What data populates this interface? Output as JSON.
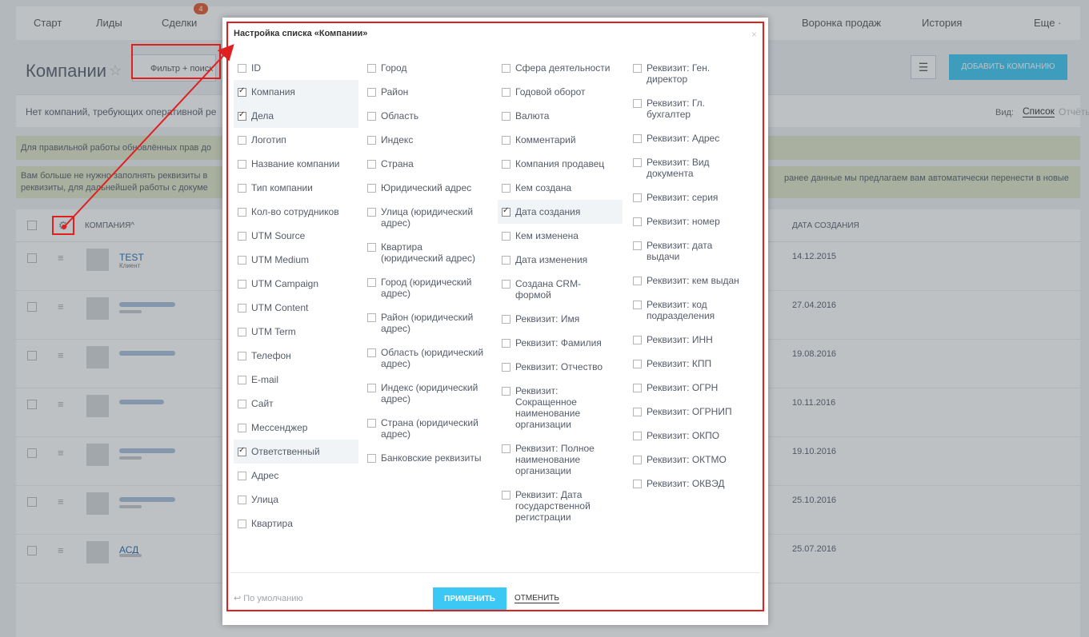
{
  "nav": {
    "items": [
      "Старт",
      "Лиды",
      "Сделки",
      "Воронка продаж",
      "История",
      "Еще ·"
    ],
    "badge": "4"
  },
  "page": {
    "title": "Компании",
    "filter_placeholder": "Фильтр + поиск",
    "add_button": "ДОБАВИТЬ КОМПАНИЮ",
    "info_text": "Нет компаний, требующих оперативной ре",
    "view_label": "Вид:",
    "view_list": "Список",
    "view_reports": "Отчёты",
    "notice1": "Для правильной работы обновлённых прав до",
    "notice2_line1": "Вам больше не нужно заполнять реквизиты в",
    "notice2_line2": "реквизиты, для дальнейшей работы с докуме",
    "notice2_right": "ранее данные мы предлагаем вам автоматически перенести в новые"
  },
  "table": {
    "col_company": "КОМПАНИЯ^",
    "col_date": "ДАТА СОЗДАНИЯ",
    "rows": [
      {
        "name": "TEST",
        "type": "Клиент",
        "date": "14.12.2015"
      },
      {
        "name": "",
        "type": "",
        "date": "27.04.2016"
      },
      {
        "name": "",
        "type": "",
        "date": "19.08.2016"
      },
      {
        "name": "",
        "type": "",
        "date": "10.11.2016"
      },
      {
        "name": "",
        "type": "",
        "date": "19.10.2016"
      },
      {
        "name": "",
        "type": "",
        "date": "25.10.2016"
      },
      {
        "name": "АСД",
        "type": "",
        "date": "25.07.2016"
      }
    ]
  },
  "modal": {
    "title": "Настройка списка «Компании»",
    "close": "×",
    "columns": [
      [
        {
          "label": "ID",
          "checked": false
        },
        {
          "label": "Компания",
          "checked": true
        },
        {
          "label": "Дела",
          "checked": true
        },
        {
          "label": "Логотип",
          "checked": false
        },
        {
          "label": "Название компании",
          "checked": false
        },
        {
          "label": "Тип компании",
          "checked": false
        },
        {
          "label": "Кол-во сотрудников",
          "checked": false
        },
        {
          "label": "UTM Source",
          "checked": false
        },
        {
          "label": "UTM Medium",
          "checked": false
        },
        {
          "label": "UTM Campaign",
          "checked": false
        },
        {
          "label": "UTM Content",
          "checked": false
        },
        {
          "label": "UTM Term",
          "checked": false
        },
        {
          "label": "Телефон",
          "checked": false
        },
        {
          "label": "E-mail",
          "checked": false
        },
        {
          "label": "Сайт",
          "checked": false
        },
        {
          "label": "Мессенджер",
          "checked": false
        },
        {
          "label": "Ответственный",
          "checked": true
        },
        {
          "label": "Адрес",
          "checked": false
        },
        {
          "label": "Улица",
          "checked": false
        },
        {
          "label": "Квартира",
          "checked": false
        }
      ],
      [
        {
          "label": "Город",
          "checked": false
        },
        {
          "label": "Район",
          "checked": false
        },
        {
          "label": "Область",
          "checked": false
        },
        {
          "label": "Индекс",
          "checked": false
        },
        {
          "label": "Страна",
          "checked": false
        },
        {
          "label": "Юридический адрес",
          "checked": false
        },
        {
          "label": "Улица (юридический адрес)",
          "checked": false
        },
        {
          "label": "Квартира (юридический адрес)",
          "checked": false
        },
        {
          "label": "Город (юридический адрес)",
          "checked": false
        },
        {
          "label": "Район (юридический адрес)",
          "checked": false
        },
        {
          "label": "Область (юридический адрес)",
          "checked": false
        },
        {
          "label": "Индекс (юридический адрес)",
          "checked": false
        },
        {
          "label": "Страна (юридический адрес)",
          "checked": false
        },
        {
          "label": "Банковские реквизиты",
          "checked": false
        }
      ],
      [
        {
          "label": "Сфера деятельности",
          "checked": false
        },
        {
          "label": "Годовой оборот",
          "checked": false
        },
        {
          "label": "Валюта",
          "checked": false
        },
        {
          "label": "Комментарий",
          "checked": false
        },
        {
          "label": "Компания продавец",
          "checked": false
        },
        {
          "label": "Кем создана",
          "checked": false
        },
        {
          "label": "Дата создания",
          "checked": true
        },
        {
          "label": "Кем изменена",
          "checked": false
        },
        {
          "label": "Дата изменения",
          "checked": false
        },
        {
          "label": "Создана CRM-формой",
          "checked": false
        },
        {
          "label": "Реквизит: Имя",
          "checked": false
        },
        {
          "label": "Реквизит: Фамилия",
          "checked": false
        },
        {
          "label": "Реквизит: Отчество",
          "checked": false
        },
        {
          "label": "Реквизит: Сокращенное наименование организации",
          "checked": false
        },
        {
          "label": "Реквизит: Полное наименование организации",
          "checked": false
        },
        {
          "label": "Реквизит: Дата государственной регистрации",
          "checked": false
        }
      ],
      [
        {
          "label": "Реквизит: Ген. директор",
          "checked": false
        },
        {
          "label": "Реквизит: Гл. бухгалтер",
          "checked": false
        },
        {
          "label": "Реквизит: Адрес",
          "checked": false
        },
        {
          "label": "Реквизит: Вид документа",
          "checked": false
        },
        {
          "label": "Реквизит: серия",
          "checked": false
        },
        {
          "label": "Реквизит: номер",
          "checked": false
        },
        {
          "label": "Реквизит: дата выдачи",
          "checked": false
        },
        {
          "label": "Реквизит: кем выдан",
          "checked": false
        },
        {
          "label": "Реквизит: код подразделения",
          "checked": false
        },
        {
          "label": "Реквизит: ИНН",
          "checked": false
        },
        {
          "label": "Реквизит: КПП",
          "checked": false
        },
        {
          "label": "Реквизит: ОГРН",
          "checked": false
        },
        {
          "label": "Реквизит: ОГРНИП",
          "checked": false
        },
        {
          "label": "Реквизит: ОКПО",
          "checked": false
        },
        {
          "label": "Реквизит: ОКТМО",
          "checked": false
        },
        {
          "label": "Реквизит: ОКВЭД",
          "checked": false
        }
      ]
    ],
    "default_link": "↩ По умолчанию",
    "apply": "ПРИМЕНИТЬ",
    "cancel": "ОТМЕНИТЬ"
  },
  "colors": {
    "accent": "#3bc8f5",
    "annotation": "#e02020",
    "notice_bg": "#dfe5c7"
  }
}
